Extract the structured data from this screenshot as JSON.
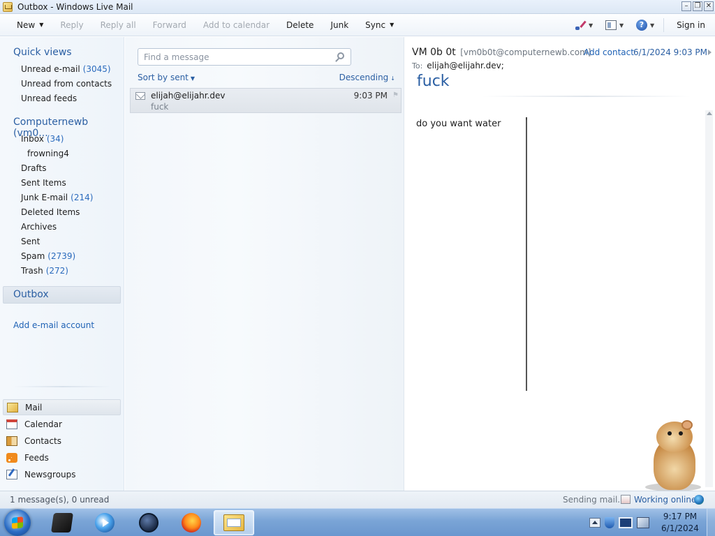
{
  "window": {
    "title": "Outbox - Windows Live Mail"
  },
  "toolbar": {
    "new_label": "New",
    "reply_label": "Reply",
    "reply_all_label": "Reply all",
    "forward_label": "Forward",
    "add_to_calendar_label": "Add to calendar",
    "delete_label": "Delete",
    "junk_label": "Junk",
    "sync_label": "Sync",
    "sign_in_label": "Sign in"
  },
  "quick_views": {
    "title": "Quick views",
    "items": [
      {
        "label": "Unread e-mail",
        "count": "(3045)"
      },
      {
        "label": "Unread from contacts",
        "count": ""
      },
      {
        "label": "Unread feeds",
        "count": ""
      }
    ]
  },
  "account": {
    "title": "Computernewb (vm0...",
    "folders": [
      {
        "label": "Inbox",
        "count": "(34)"
      },
      {
        "label": "frowning4",
        "count": ""
      },
      {
        "label": "Drafts",
        "count": ""
      },
      {
        "label": "Sent Items",
        "count": ""
      },
      {
        "label": "Junk E-mail",
        "count": "(214)"
      },
      {
        "label": "Deleted Items",
        "count": ""
      },
      {
        "label": "Archives",
        "count": ""
      },
      {
        "label": "Sent",
        "count": ""
      },
      {
        "label": "Spam",
        "count": "(2739)"
      },
      {
        "label": "Trash",
        "count": "(272)"
      }
    ]
  },
  "outbox": {
    "label": "Outbox"
  },
  "add_account_label": "Add e-mail account",
  "switcher": {
    "items": [
      {
        "label": "Mail",
        "icon": "mail-icon"
      },
      {
        "label": "Calendar",
        "icon": "calendar-icon"
      },
      {
        "label": "Contacts",
        "icon": "contacts-icon"
      },
      {
        "label": "Feeds",
        "icon": "feeds-icon"
      },
      {
        "label": "Newsgroups",
        "icon": "newsgroups-icon"
      }
    ]
  },
  "message_list": {
    "search_placeholder": "Find a message",
    "sort_by": "Sort by sent",
    "sort_direction": "Descending",
    "messages": [
      {
        "from": "elijah@elijahr.dev",
        "time": "9:03 PM",
        "subject": "fuck"
      }
    ]
  },
  "reading_pane": {
    "sender_name": "VM 0b 0t",
    "sender_address": "[vm0b0t@computernewb.com]",
    "add_contact_label": "Add contact",
    "date": "6/1/2024 9:03 PM",
    "to_label": "To:",
    "to_value": "elijah@elijahr.dev;",
    "subject": "fuck",
    "body": "do you want water"
  },
  "status_bar": {
    "message_count": "1 message(s), 0 unread",
    "sending": "Sending mail...",
    "online": "Working online"
  },
  "taskbar": {
    "time": "9:17 PM",
    "date": "6/1/2024"
  },
  "colors": {
    "accent": "#2b5fa3",
    "link": "#1f62b5",
    "count": "#2b6bbd",
    "taskbar": "#7aa4d6"
  }
}
